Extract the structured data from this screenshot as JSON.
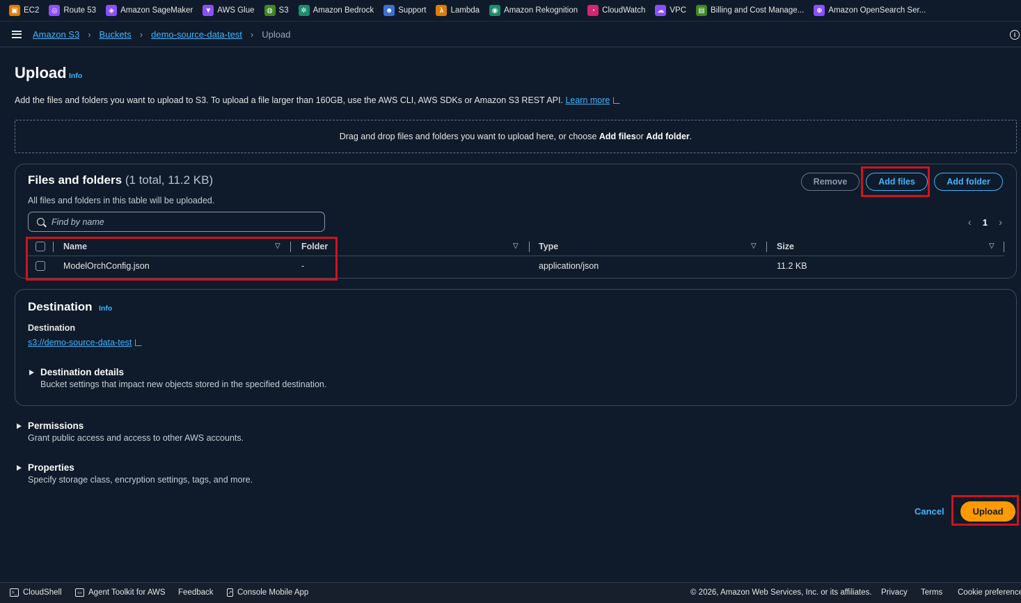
{
  "favorites": [
    {
      "label": "EC2",
      "icon": "ec2-icon",
      "color": "#e07b00",
      "glyph": "▣"
    },
    {
      "label": "Route 53",
      "icon": "route53-icon",
      "color": "#8c4fff",
      "glyph": "◎"
    },
    {
      "label": "Amazon SageMaker",
      "icon": "sagemaker-icon",
      "color": "#8c4fff",
      "glyph": "◈"
    },
    {
      "label": "AWS Glue",
      "icon": "glue-icon",
      "color": "#8c4fff",
      "glyph": "▼"
    },
    {
      "label": "S3",
      "icon": "s3-icon",
      "color": "#3f8624",
      "glyph": "◍"
    },
    {
      "label": "Amazon Bedrock",
      "icon": "bedrock-icon",
      "color": "#1b8c6c",
      "glyph": "✲"
    },
    {
      "label": "Support",
      "icon": "support-icon",
      "color": "#3b6fd1",
      "glyph": "☻"
    },
    {
      "label": "Lambda",
      "icon": "lambda-icon",
      "color": "#e07b00",
      "glyph": "λ"
    },
    {
      "label": "Amazon Rekognition",
      "icon": "rekognition-icon",
      "color": "#1b8c6c",
      "glyph": "◉"
    },
    {
      "label": "CloudWatch",
      "icon": "cloudwatch-icon",
      "color": "#d6246e",
      "glyph": "◔"
    },
    {
      "label": "VPC",
      "icon": "vpc-icon",
      "color": "#8c4fff",
      "glyph": "☁"
    },
    {
      "label": "Billing and Cost Manage...",
      "icon": "billing-icon",
      "color": "#3f8624",
      "glyph": "▤"
    },
    {
      "label": "Amazon OpenSearch Ser...",
      "icon": "opensearch-icon",
      "color": "#8c4fff",
      "glyph": "⊕"
    }
  ],
  "breadcrumb": [
    "Amazon S3",
    "Buckets",
    "demo-source-data-test",
    "Upload"
  ],
  "page": {
    "title": "Upload",
    "info": "Info",
    "description": "Add the files and folders you want to upload to S3. To upload a file larger than 160GB, use the AWS CLI, AWS SDKs or Amazon S3 REST API.",
    "learn_more": "Learn more"
  },
  "dropzone": {
    "text_before": "Drag and drop files and folders you want to upload here, or choose ",
    "add_files": "Add files",
    "or": " or ",
    "add_folder": "Add folder",
    "period": "."
  },
  "files_panel": {
    "title": "Files and folders",
    "count": "(1 total, 11.2 KB)",
    "subtitle": "All files and folders in this table will be uploaded.",
    "remove_label": "Remove",
    "add_files_label": "Add files",
    "add_folder_label": "Add folder",
    "search_placeholder": "Find by name",
    "page_number": "1",
    "columns": [
      "Name",
      "Folder",
      "Type",
      "Size"
    ],
    "rows": [
      {
        "name": "ModelOrchConfig.json",
        "folder": "-",
        "type": "application/json",
        "size": "11.2 KB"
      }
    ]
  },
  "destination_panel": {
    "title": "Destination",
    "info": "Info",
    "label": "Destination",
    "link": "s3://demo-source-data-test",
    "details_title": "Destination details",
    "details_desc": "Bucket settings that impact new objects stored in the specified destination."
  },
  "permissions": {
    "title": "Permissions",
    "desc": "Grant public access and access to other AWS accounts."
  },
  "properties": {
    "title": "Properties",
    "desc": "Specify storage class, encryption settings, tags, and more."
  },
  "actions": {
    "cancel": "Cancel",
    "upload": "Upload"
  },
  "footer": {
    "cloudshell": "CloudShell",
    "agent_toolkit": "Agent Toolkit for AWS",
    "feedback": "Feedback",
    "mobile_app": "Console Mobile App",
    "copyright": "© 2026, Amazon Web Services, Inc. or its affiliates.",
    "privacy": "Privacy",
    "terms": "Terms",
    "cookies": "Cookie preferences"
  },
  "colors": {
    "accent": "#42b4ff",
    "primary_button": "#ff9900",
    "highlight": "#d1121f",
    "background": "#0f1b2a"
  }
}
